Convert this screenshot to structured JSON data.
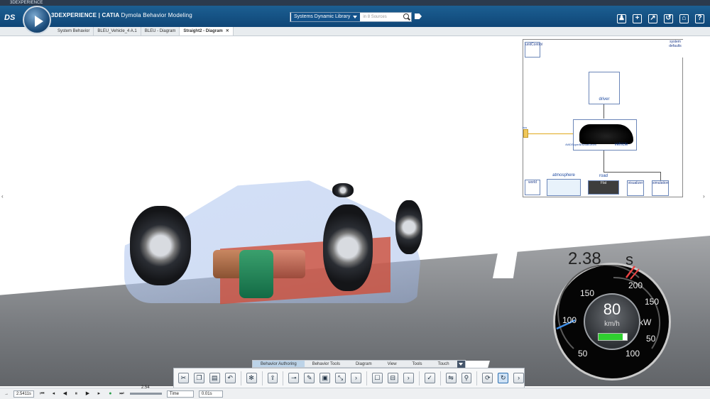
{
  "os": {
    "title": "3DEXPERIENCE"
  },
  "header": {
    "brand": "3DEXPERIENCE | CATIA",
    "product": "Dymola Behavior Modeling",
    "search": {
      "library": "Systems Dynamic Library",
      "placeholder": "in 8 Sources"
    }
  },
  "tabs": [
    {
      "label": "System Behavior"
    },
    {
      "label": "BLEU_Vehicle_4 A.1"
    },
    {
      "label": "BLEU - Diagram"
    },
    {
      "label": "Straight2 - Diagram",
      "close": "✕"
    }
  ],
  "diagram": {
    "blocks": {
      "unitControl": "unitControl",
      "system": "system",
      "defaults": "defaults",
      "driver": "driver",
      "vehicle": "vehicle",
      "vehicle_model": "4WDSuperBrtDualGeom",
      "world": "world",
      "atmosphere": "atmosphere",
      "road": "road",
      "road_sub": "Flat",
      "visualizer": "visualizer",
      "simulation": "simulation",
      "bus": "bus"
    }
  },
  "scene": {
    "time_value": "2.38",
    "time_unit": "s",
    "speedometer": {
      "speed": "80",
      "unit": "km/h",
      "power_unit": "kW",
      "battery_fraction": 0.85,
      "left_ticks": [
        "50",
        "100",
        "150"
      ],
      "right_ticks": [
        "50",
        "100",
        "150",
        "200"
      ]
    }
  },
  "ribbon": {
    "tabs": [
      "Behavior Authoring",
      "Behavior Tools",
      "Diagram",
      "View",
      "Tools",
      "Touch"
    ],
    "active": "Behavior Authoring"
  },
  "player": {
    "time_field": "2.5411s",
    "slider_value": "2.54",
    "mode": "Time",
    "step": "0.01s"
  }
}
